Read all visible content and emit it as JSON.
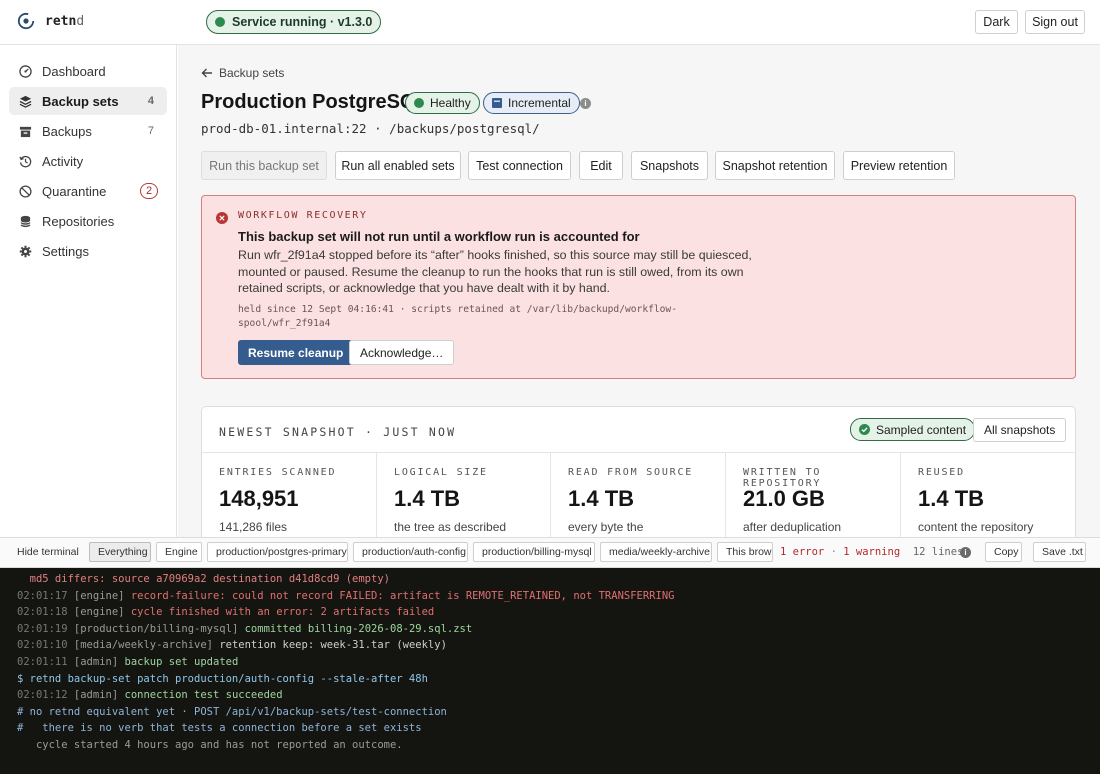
{
  "header": {
    "app_name_main": "retn",
    "app_name_tail": "d",
    "service_status": "Service running · v1.3.0",
    "dark_label": "Dark",
    "signout_label": "Sign out",
    "colors": {
      "ok": "#2d8a4e"
    }
  },
  "sidebar": {
    "items": [
      {
        "label": "Dashboard",
        "icon": "gauge-icon"
      },
      {
        "label": "Backup sets",
        "icon": "layers-icon",
        "count": "4"
      },
      {
        "label": "Backups",
        "icon": "archive-icon",
        "count": "7"
      },
      {
        "label": "Activity",
        "icon": "history-icon"
      },
      {
        "label": "Quarantine",
        "icon": "blocked-icon",
        "count": "2"
      },
      {
        "label": "Repositories",
        "icon": "database-icon"
      },
      {
        "label": "Settings",
        "icon": "gear-icon"
      }
    ]
  },
  "page": {
    "back_label": "Backup sets",
    "title": "Production PostgreSQL",
    "badges": {
      "health": "Healthy",
      "mode": "Incremental"
    },
    "source_host": "prod-db-01.internal:22",
    "separator": "·",
    "source_path": "/backups/postgresql/",
    "actions": [
      "Run this backup set",
      "Run all enabled sets",
      "Test connection",
      "Edit",
      "Snapshots",
      "Snapshot retention",
      "Preview retention"
    ]
  },
  "alert": {
    "caption": "WORKFLOW RECOVERY",
    "heading": "This backup set will not run until a workflow run is accounted for",
    "body": "Run wfr_2f91a4 stopped before its “after” hooks finished, so this source may still be quiesced, mounted or paused. Resume the cleanup to run the hooks that run is still owed, from its own retained scripts, or acknowledge that you have dealt with it by hand.",
    "meta": "held since 12 Sept 04:16:41 · scripts retained at /var/lib/backupd/workflow-spool/wfr_2f91a4",
    "primary_label": "Resume cleanup",
    "secondary_label": "Acknowledge…"
  },
  "snapshot": {
    "caption": "NEWEST SNAPSHOT · JUST NOW",
    "sampled_label": "Sampled content",
    "all_label": "All snapshots",
    "stats": [
      {
        "label": "ENTRIES SCANNED",
        "value": "148,951",
        "desc": "141,286 files"
      },
      {
        "label": "LOGICAL SIZE",
        "value": "1.4 TB",
        "desc": "the tree as described"
      },
      {
        "label": "READ FROM SOURCE",
        "value": "1.4 TB",
        "desc": "every byte the"
      },
      {
        "label": "WRITTEN TO REPOSITORY",
        "value": "21.0 GB",
        "desc": "after deduplication"
      },
      {
        "label": "REUSED",
        "value": "1.4 TB",
        "desc": "content the repository"
      }
    ]
  },
  "terminal_bar": {
    "hide_label": "Hide terminal",
    "filters": [
      "Everything",
      "Engine",
      "production/postgres-primary",
      "production/auth-config",
      "production/billing-mysql",
      "media/weekly-archive",
      "This browser"
    ],
    "summary_error": "1 error",
    "summary_sep": "·",
    "summary_warning": "1 warning",
    "summary_lines": "12 lines",
    "copy_label": "Copy",
    "save_label": "Save .txt"
  },
  "terminal": {
    "lines": [
      {
        "time": "",
        "tag": "",
        "text": "  md5 differs: source a70969a2 destination d41d8cd9 (empty)",
        "kind": "err"
      },
      {
        "time": "02:01:17",
        "tag": "[engine]",
        "text": "record-failure: could not record FAILED: artifact is REMOTE_RETAINED, not TRANSFERRING",
        "kind": "err"
      },
      {
        "time": "02:01:18",
        "tag": "[engine]",
        "text": "cycle finished with an error: 2 artifacts failed",
        "kind": "err"
      },
      {
        "time": "02:01:19",
        "tag": "[production/billing-mysql]",
        "text": "committed billing-2026-08-29.sql.zst",
        "kind": "ok"
      },
      {
        "time": "02:01:10",
        "tag": "[media/weekly-archive]",
        "text": "retention keep: week-31.tar (weekly)",
        "kind": "plain"
      },
      {
        "time": "02:01:11",
        "tag": "[admin]",
        "text": "backup set updated",
        "kind": "ok"
      },
      {
        "time": "",
        "tag": "",
        "text": "$ retnd backup-set patch production/auth-config --stale-after 48h",
        "kind": "cmd"
      },
      {
        "time": "02:01:12",
        "tag": "[admin]",
        "text": "connection test succeeded",
        "kind": "ok"
      },
      {
        "time": "",
        "tag": "",
        "text": "# no retnd equivalent yet · POST /api/v1/backup-sets/test-connection",
        "kind": "cmt"
      },
      {
        "time": "",
        "tag": "",
        "text": "#   there is no verb that tests a connection before a set exists",
        "kind": "cmt"
      },
      {
        "time": "",
        "tag": "",
        "text": "   cycle started 4 hours ago and has not reported an outcome.",
        "kind": "dim"
      }
    ]
  }
}
